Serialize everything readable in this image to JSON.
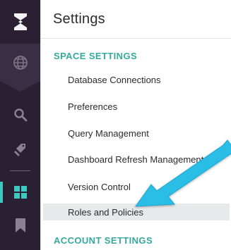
{
  "rail": {
    "icons": [
      "logo-icon",
      "globe-icon",
      "search-icon",
      "tag-icon",
      "dashboard-icon",
      "bookmark-icon"
    ],
    "accent_color": "#3ec8c0"
  },
  "panel": {
    "title": "Settings",
    "sections": [
      {
        "heading": "SPACE SETTINGS",
        "items": [
          "Database Connections",
          "Preferences",
          "Query Management",
          "Dashboard Refresh Management",
          "Version Control",
          "Roles and Policies"
        ],
        "selected": "Roles and Policies"
      },
      {
        "heading": "ACCOUNT SETTINGS",
        "items": []
      }
    ]
  },
  "colors": {
    "rail_bg": "#2a1f33",
    "section_heading": "#35a99f",
    "selected_bg": "#e8e9ea",
    "annotation_arrow": "#29bde6"
  }
}
